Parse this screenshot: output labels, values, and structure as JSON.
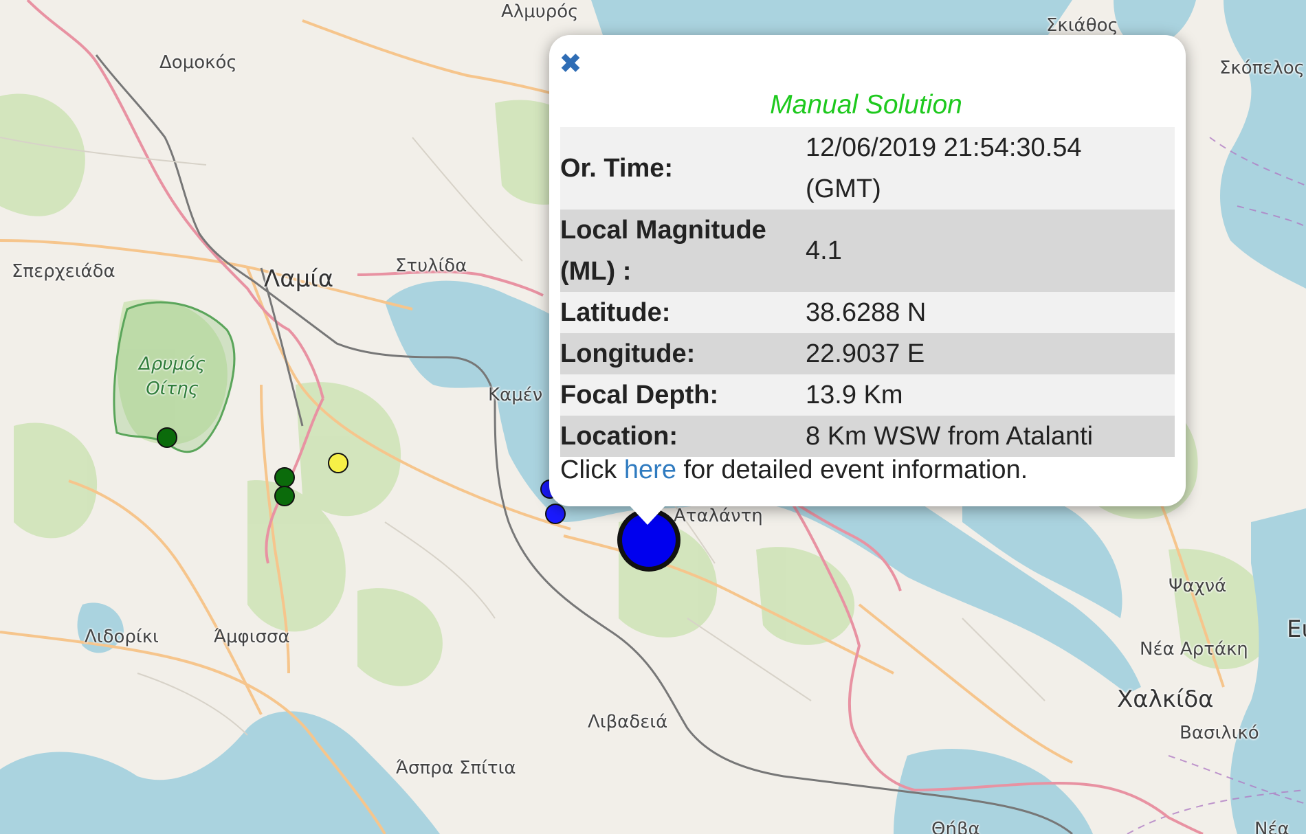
{
  "map": {
    "labels": {
      "almyros": "Αλμυρός",
      "skiathos": "Σκιάθος",
      "skopelos": "Σκόπελος",
      "domokos": "Δομοκός",
      "spercheiada": "Σπερχειάδα",
      "lamia": "Λαμία",
      "stylida": "Στυλίδα",
      "drymos_oitis": "Δρυμός\nΟίτης",
      "kamena": "Καμέν",
      "atalanti": "Αταλάντη",
      "psachna": "Ψαχνά",
      "nea_artaki": "Νέα Αρτάκη",
      "chalkida": "Χαλκίδα",
      "vasiliko": "Βασιλικό",
      "lidoriki": "Λιδορίκι",
      "amfissa": "Άμφισσα",
      "livadeia": "Λιβαδειά",
      "aspra_spitia": "Άσπρα Σπίτια",
      "thiva": "Θήβα",
      "nea": "Νέα",
      "edge_e": "Ει"
    },
    "colors": {
      "land": "#f2efe9",
      "sea": "#aad3df",
      "forest": "#c8dfb2",
      "park_border": "#5aa55a",
      "motorway": "#e892a2",
      "primary_road": "#f6c58c",
      "railway": "#777777",
      "boundary": "#b07dc4"
    },
    "markers": [
      {
        "name": "event-marker-green-1",
        "color": "#0b6b0b"
      },
      {
        "name": "event-marker-green-2",
        "color": "#0b6b0b"
      },
      {
        "name": "event-marker-green-3",
        "color": "#0b6b0b"
      },
      {
        "name": "event-marker-yellow",
        "color": "#f7f047"
      },
      {
        "name": "event-marker-blue-small-1",
        "color": "#1a1aff"
      },
      {
        "name": "event-marker-blue-small-2",
        "color": "#1a1aff"
      },
      {
        "name": "event-marker-blue-selected",
        "color": "#0000ee"
      }
    ]
  },
  "popup": {
    "close_icon": "✖",
    "title": "Manual Solution",
    "title_color": "#1ec91e",
    "rows": [
      {
        "label": "Or. Time:",
        "value": "12/06/2019 21:54:30.54\n(GMT)"
      },
      {
        "label": "Local Magnitude\n(ML) :",
        "value": "4.1"
      },
      {
        "label": "Latitude:",
        "value": "38.6288 N"
      },
      {
        "label": "Longitude:",
        "value": "22.9037 E"
      },
      {
        "label": "Focal Depth:",
        "value": "13.9 Km"
      },
      {
        "label": "Location:",
        "value": "8 Km WSW from Atalanti"
      }
    ],
    "detail_prefix": "Click",
    "detail_link": "here",
    "detail_suffix": "for detailed event information."
  }
}
